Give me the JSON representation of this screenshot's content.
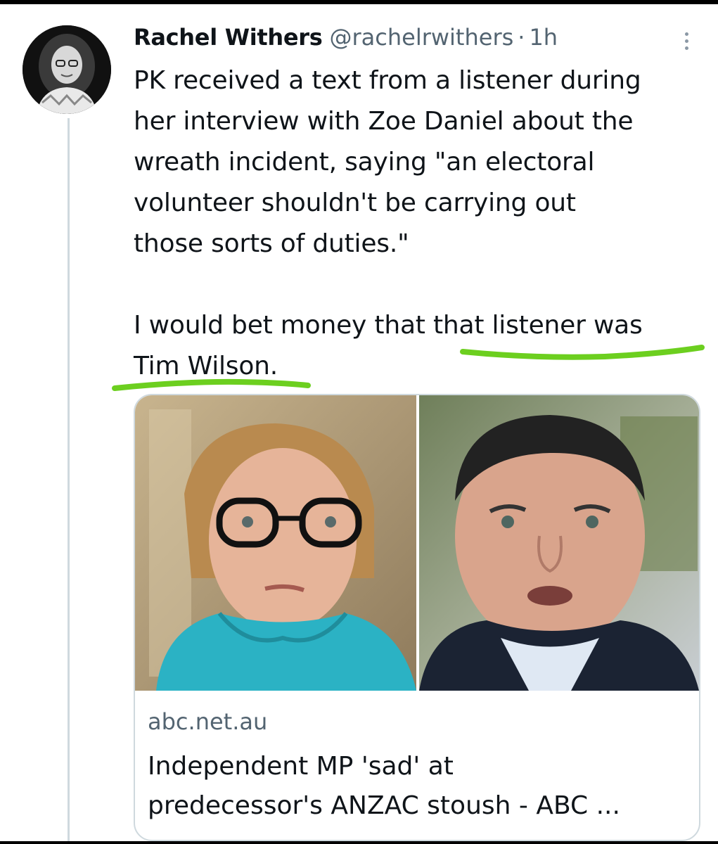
{
  "tweet": {
    "author_name": "Rachel Withers",
    "author_handle": "@rachelrwithers",
    "separator": "·",
    "time": "1h",
    "paragraph1_lines": [
      "PK received a text from a listener during",
      "her interview with Zoe Daniel about the",
      "wreath incident, saying \"an electoral",
      "volunteer shouldn't be carrying out",
      "those sorts of duties.\""
    ],
    "paragraph2_line1": "I would bet money that that listener was",
    "paragraph2_line2": "Tim Wilson."
  },
  "card": {
    "domain": "abc.net.au",
    "title_line1": "Independent MP 'sad' at",
    "title_line2": "predecessor's ANZAC stoush - ABC ..."
  },
  "icons": {
    "more": "more-vertical-icon"
  },
  "colors": {
    "underline": "#6ccf1f",
    "secondary_text": "#536471",
    "border": "#cfd9de"
  }
}
